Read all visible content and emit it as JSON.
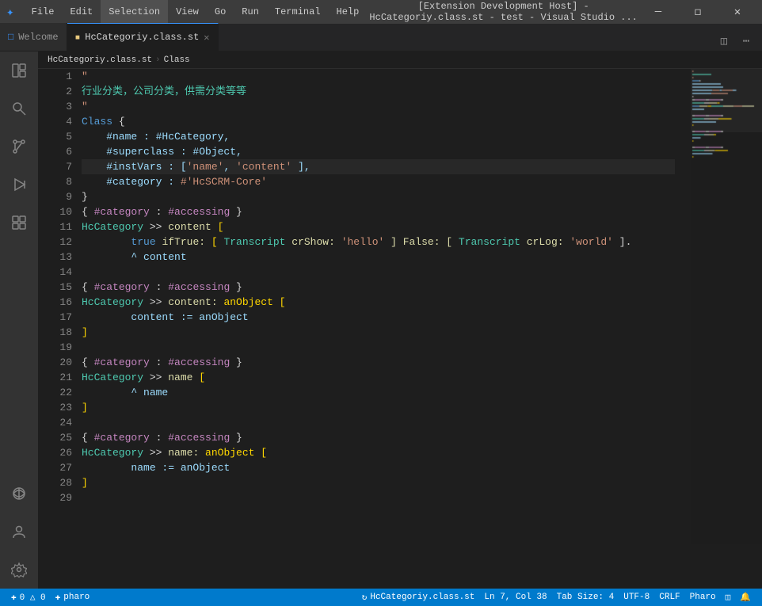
{
  "titleBar": {
    "title": "[Extension Development Host] - HcCategoriy.class.st - test - Visual Studio ...",
    "menus": [
      "File",
      "Edit",
      "Selection",
      "View",
      "Go",
      "Run",
      "Terminal",
      "Help"
    ],
    "activeMenu": "Selection",
    "winButtons": [
      "—",
      "❐",
      "✕"
    ]
  },
  "tabs": [
    {
      "id": "welcome",
      "label": "Welcome",
      "icon": "⊞",
      "active": false,
      "closeable": false
    },
    {
      "id": "hccategory",
      "label": "HcCategoriy.class.st",
      "icon": "◻",
      "active": true,
      "closeable": true
    }
  ],
  "tabBarActions": [
    "⊟",
    "⋯"
  ],
  "breadcrumb": {
    "items": [
      "HcCategoriy.class.st",
      "Class"
    ]
  },
  "activityBar": {
    "items": [
      {
        "id": "explorer",
        "icon": "⧉",
        "active": false
      },
      {
        "id": "search",
        "icon": "🔍",
        "active": false
      },
      {
        "id": "source-control",
        "icon": "⑂",
        "active": false
      },
      {
        "id": "run",
        "icon": "▷",
        "active": false
      },
      {
        "id": "extensions",
        "icon": "⊞",
        "active": false
      }
    ],
    "bottomItems": [
      {
        "id": "remote",
        "icon": "⊕"
      },
      {
        "id": "account",
        "icon": "👤"
      },
      {
        "id": "settings",
        "icon": "⚙"
      }
    ]
  },
  "editor": {
    "lines": [
      {
        "num": 1,
        "tokens": [
          {
            "text": "\"",
            "class": "c-string"
          }
        ]
      },
      {
        "num": 2,
        "tokens": [
          {
            "text": "行业分类，公司分类，供需分类等等",
            "class": "c-chinese"
          }
        ]
      },
      {
        "num": 3,
        "tokens": [
          {
            "text": "\"",
            "class": "c-string"
          }
        ]
      },
      {
        "num": 4,
        "tokens": [
          {
            "text": "Class ",
            "class": "c-keyword"
          },
          {
            "text": "{",
            "class": "c-punct"
          }
        ]
      },
      {
        "num": 5,
        "tokens": [
          {
            "text": "    #name : #HcCategory,",
            "class": "c-var"
          }
        ]
      },
      {
        "num": 6,
        "tokens": [
          {
            "text": "    #superclass : #Object,",
            "class": "c-var"
          }
        ]
      },
      {
        "num": 7,
        "tokens": [
          {
            "text": "    #instVars : [",
            "class": "c-var"
          },
          {
            "text": "'name'",
            "class": "c-string"
          },
          {
            "text": ", ",
            "class": "c-var"
          },
          {
            "text": "'content'",
            "class": "c-string"
          },
          {
            "text": " ],",
            "class": "c-var"
          }
        ],
        "highlighted": true
      },
      {
        "num": 8,
        "tokens": [
          {
            "text": "    #category : ",
            "class": "c-var"
          },
          {
            "text": "#'HcSCRM-Core'",
            "class": "c-string"
          }
        ]
      },
      {
        "num": 9,
        "tokens": [
          {
            "text": "}",
            "class": "c-punct"
          }
        ]
      },
      {
        "num": 10,
        "tokens": [
          {
            "text": "{ ",
            "class": "c-punct"
          },
          {
            "text": "#category",
            "class": "c-symbol"
          },
          {
            "text": " : ",
            "class": "c-punct"
          },
          {
            "text": "#accessing",
            "class": "c-symbol"
          },
          {
            "text": " }",
            "class": "c-punct"
          }
        ]
      },
      {
        "num": 11,
        "tokens": [
          {
            "text": "HcCategory",
            "class": "c-class"
          },
          {
            "text": " >> ",
            "class": "c-punct"
          },
          {
            "text": "content",
            "class": "c-method"
          },
          {
            "text": " [",
            "class": "c-bracket"
          }
        ]
      },
      {
        "num": 12,
        "tokens": [
          {
            "text": "\ttrue ",
            "class": "c-bool"
          },
          {
            "text": "ifTrue:",
            "class": "c-msg"
          },
          {
            "text": " [ ",
            "class": "c-bracket"
          },
          {
            "text": "Transcript",
            "class": "c-class"
          },
          {
            "text": " crShow: ",
            "class": "c-msg"
          },
          {
            "text": "'hello'",
            "class": "c-string"
          },
          {
            "text": " ] False: [ ",
            "class": "c-msg"
          },
          {
            "text": "Transcript",
            "class": "c-class"
          },
          {
            "text": " crLog: ",
            "class": "c-msg"
          },
          {
            "text": "'world'",
            "class": "c-string"
          },
          {
            "text": " ].",
            "class": "c-punct"
          }
        ]
      },
      {
        "num": 13,
        "tokens": [
          {
            "text": "\t^ content",
            "class": "c-var"
          }
        ]
      },
      {
        "num": 14,
        "tokens": []
      },
      {
        "num": 15,
        "tokens": [
          {
            "text": "{ ",
            "class": "c-punct"
          },
          {
            "text": "#category",
            "class": "c-symbol"
          },
          {
            "text": " : ",
            "class": "c-punct"
          },
          {
            "text": "#accessing",
            "class": "c-symbol"
          },
          {
            "text": " }",
            "class": "c-punct"
          }
        ]
      },
      {
        "num": 16,
        "tokens": [
          {
            "text": "HcCategory",
            "class": "c-class"
          },
          {
            "text": " >> ",
            "class": "c-punct"
          },
          {
            "text": "content:",
            "class": "c-method"
          },
          {
            "text": " anObject [",
            "class": "c-bracket"
          }
        ]
      },
      {
        "num": 17,
        "tokens": [
          {
            "text": "\tcontent := anObject",
            "class": "c-var"
          }
        ]
      },
      {
        "num": 18,
        "tokens": [
          {
            "text": "]",
            "class": "c-bracket"
          }
        ]
      },
      {
        "num": 19,
        "tokens": []
      },
      {
        "num": 20,
        "tokens": [
          {
            "text": "{ ",
            "class": "c-punct"
          },
          {
            "text": "#category",
            "class": "c-symbol"
          },
          {
            "text": " : ",
            "class": "c-punct"
          },
          {
            "text": "#accessing",
            "class": "c-symbol"
          },
          {
            "text": " }",
            "class": "c-punct"
          }
        ]
      },
      {
        "num": 21,
        "tokens": [
          {
            "text": "HcCategory",
            "class": "c-class"
          },
          {
            "text": " >> ",
            "class": "c-punct"
          },
          {
            "text": "name",
            "class": "c-method"
          },
          {
            "text": " [",
            "class": "c-bracket"
          }
        ]
      },
      {
        "num": 22,
        "tokens": [
          {
            "text": "\t^ name",
            "class": "c-var"
          }
        ]
      },
      {
        "num": 23,
        "tokens": [
          {
            "text": "]",
            "class": "c-bracket"
          }
        ]
      },
      {
        "num": 24,
        "tokens": []
      },
      {
        "num": 25,
        "tokens": [
          {
            "text": "{ ",
            "class": "c-punct"
          },
          {
            "text": "#category",
            "class": "c-symbol"
          },
          {
            "text": " : ",
            "class": "c-punct"
          },
          {
            "text": "#accessing",
            "class": "c-symbol"
          },
          {
            "text": " }",
            "class": "c-punct"
          }
        ]
      },
      {
        "num": 26,
        "tokens": [
          {
            "text": "HcCategory",
            "class": "c-class"
          },
          {
            "text": " >> ",
            "class": "c-punct"
          },
          {
            "text": "name:",
            "class": "c-method"
          },
          {
            "text": " anObject [",
            "class": "c-bracket"
          }
        ]
      },
      {
        "num": 27,
        "tokens": [
          {
            "text": "\tname := anObject",
            "class": "c-var"
          }
        ]
      },
      {
        "num": 28,
        "tokens": [
          {
            "text": "]",
            "class": "c-bracket"
          }
        ]
      },
      {
        "num": 29,
        "tokens": []
      }
    ]
  },
  "statusBar": {
    "left": [
      {
        "id": "remote",
        "text": "⊕ 0 △ 0",
        "icon": ""
      },
      {
        "id": "pharo",
        "text": "⊕ pharo"
      }
    ],
    "right": [
      {
        "id": "sync",
        "text": "↻ HcCategoriy.class.st"
      },
      {
        "id": "position",
        "text": "Ln 7, Col 38"
      },
      {
        "id": "tabsize",
        "text": "Tab Size: 4"
      },
      {
        "id": "encoding",
        "text": "UTF-8"
      },
      {
        "id": "eol",
        "text": "CRLF"
      },
      {
        "id": "language",
        "text": "Pharo"
      },
      {
        "id": "layout",
        "text": "⊟"
      },
      {
        "id": "bell",
        "text": "🔔"
      }
    ]
  }
}
